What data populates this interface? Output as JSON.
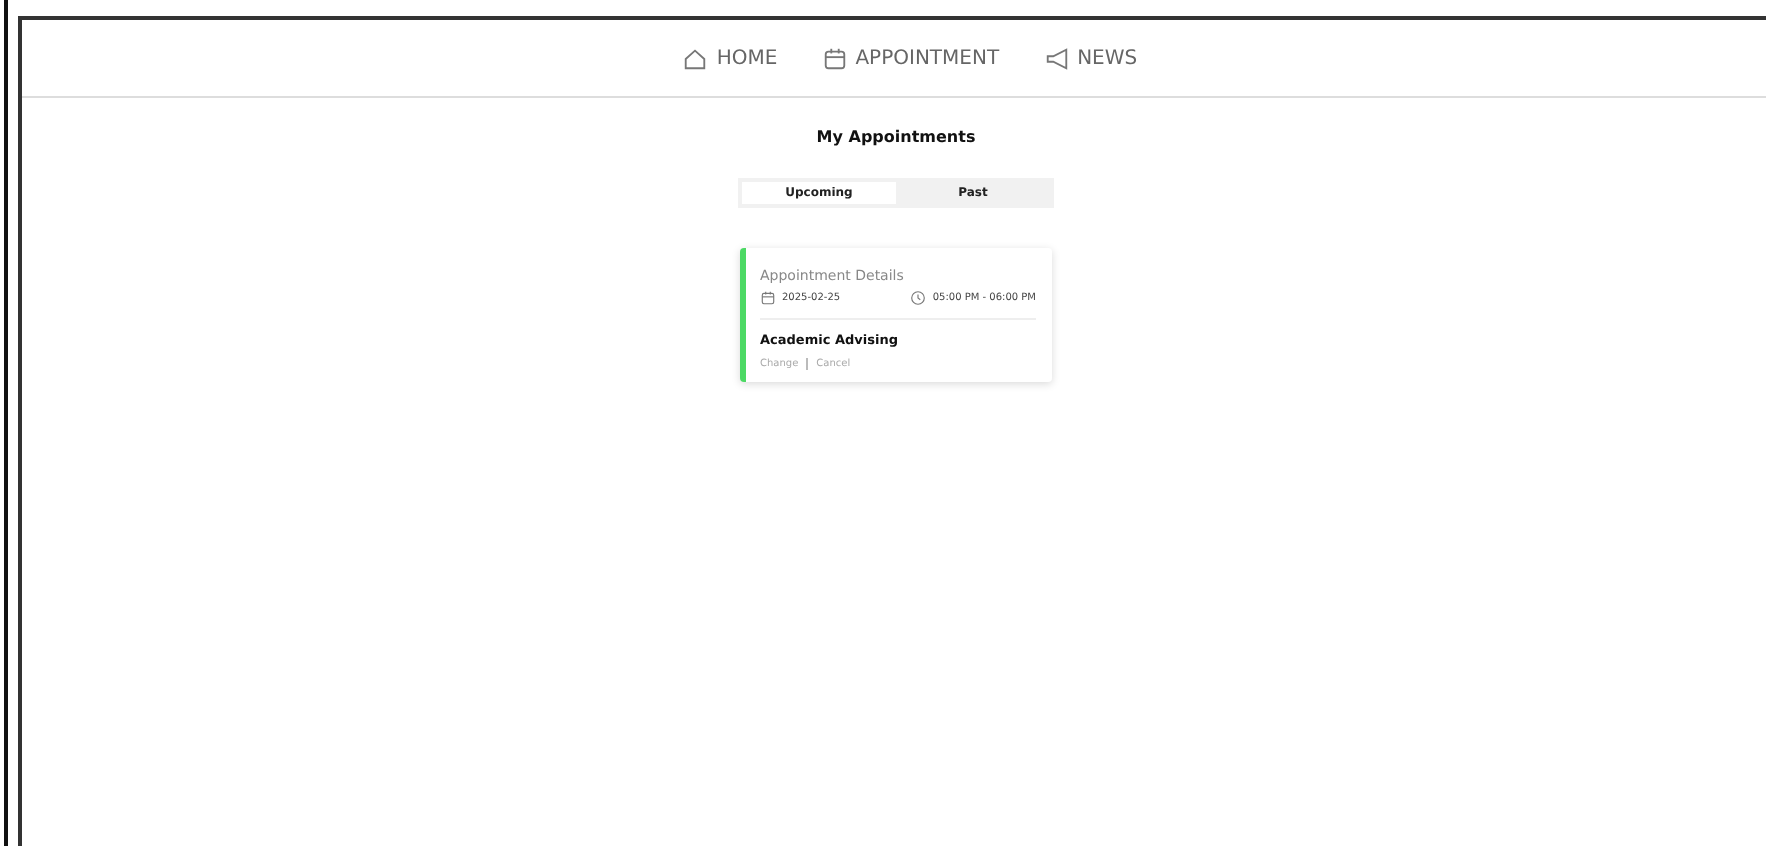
{
  "nav": [
    {
      "label": "HOME",
      "kind": "home"
    },
    {
      "label": "APPOINTMENT",
      "kind": "calendar"
    },
    {
      "label": "NEWS",
      "kind": "megaphone"
    }
  ],
  "title": "My Appointments",
  "tabs": [
    {
      "label": "Upcoming",
      "selected": true
    },
    {
      "label": "Past",
      "selected": false
    }
  ],
  "appointments": [
    {
      "heading": "Appointment Details",
      "date": "2025-02-25",
      "time": "05:00 PM - 06:00 PM",
      "service": "Academic Advising",
      "color": "#4cd964",
      "actions": [
        "Change",
        "Cancel"
      ]
    }
  ]
}
